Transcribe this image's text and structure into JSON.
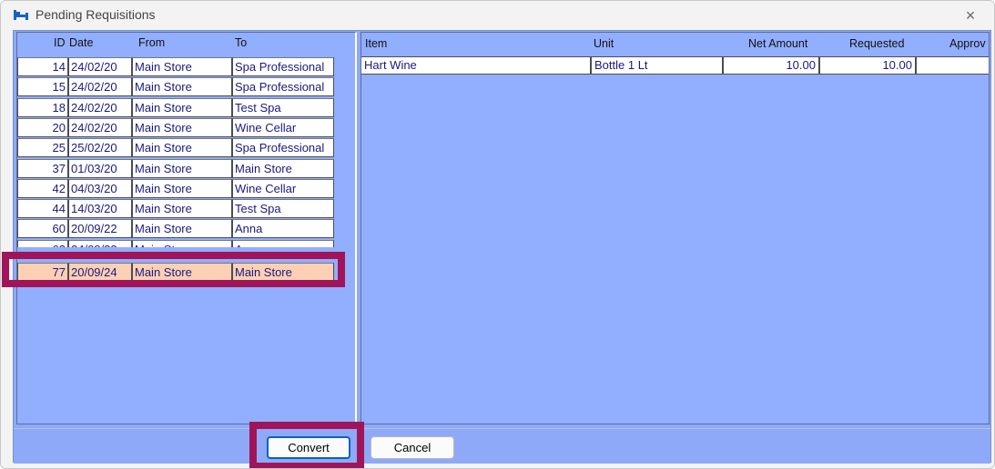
{
  "window": {
    "title": "Pending Requisitions",
    "close_symbol": "×"
  },
  "requisitions": {
    "headers": {
      "id": "ID",
      "date": "Date",
      "from": "From",
      "to": "To"
    },
    "rows": [
      {
        "id": "14",
        "date": "24/02/20",
        "from": "Main Store",
        "to": "Spa Professional"
      },
      {
        "id": "15",
        "date": "24/02/20",
        "from": "Main Store",
        "to": "Spa Professional"
      },
      {
        "id": "18",
        "date": "24/02/20",
        "from": "Main Store",
        "to": "Test Spa"
      },
      {
        "id": "20",
        "date": "24/02/20",
        "from": "Main Store",
        "to": "Wine Cellar"
      },
      {
        "id": "25",
        "date": "25/02/20",
        "from": "Main Store",
        "to": "Spa Professional"
      },
      {
        "id": "37",
        "date": "01/03/20",
        "from": "Main Store",
        "to": "Main Store"
      },
      {
        "id": "42",
        "date": "04/03/20",
        "from": "Main Store",
        "to": "Wine Cellar"
      },
      {
        "id": "44",
        "date": "14/03/20",
        "from": "Main Store",
        "to": "Test Spa"
      },
      {
        "id": "60",
        "date": "20/09/22",
        "from": "Main Store",
        "to": "Anna"
      },
      {
        "id": "63",
        "date": "24/08/23",
        "from": "Main Store",
        "to": "Anna"
      },
      {
        "id": "77",
        "date": "20/09/24",
        "from": "Main Store",
        "to": "Main Store"
      }
    ]
  },
  "items": {
    "headers": {
      "item": "Item",
      "unit": "Unit",
      "net_amount": "Net Amount",
      "requested": "Requested",
      "approved": "Approv"
    },
    "rows": [
      {
        "item": "Hart Wine",
        "unit": "Bottle 1 Lt",
        "net_amount": "10.00",
        "requested": "10.00",
        "approved": "."
      }
    ]
  },
  "buttons": {
    "convert": "Convert",
    "cancel": "Cancel"
  },
  "colors": {
    "panel_blue": "#92aefe",
    "selected_row": "#fbd0b4",
    "highlight": "#a0155a",
    "cell_text": "#1a1a80"
  }
}
